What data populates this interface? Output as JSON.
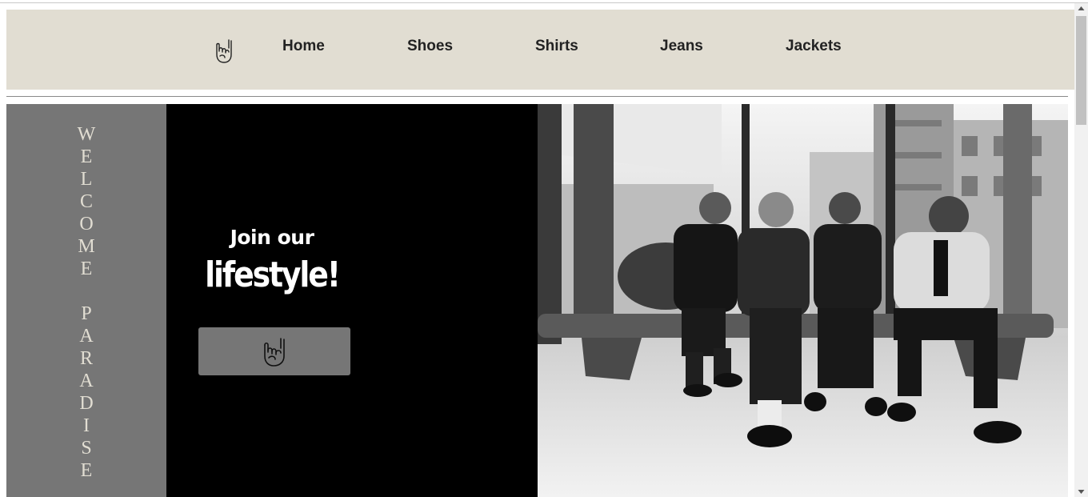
{
  "nav": {
    "logo_icon": "rock-hand-icon",
    "links": [
      "Home",
      "Shoes",
      "Shirts",
      "Jeans",
      "Jackets"
    ]
  },
  "hero": {
    "welcome_letters": [
      "W",
      "E",
      "L",
      "C",
      "O",
      "M",
      "E",
      "",
      "P",
      "A",
      "R",
      "A",
      "D",
      "I",
      "S",
      "E"
    ],
    "join_text": "Join our",
    "lifestyle_text": "lifestyle!",
    "cta_icon": "rock-hand-icon"
  },
  "colors": {
    "nav_bg": "#e1ddd2",
    "side_gray": "#767676",
    "cta_bg": "#000000",
    "text_light": "#e1ddd2"
  },
  "photo": {
    "subject": "band-photo",
    "tone": "black-and-white"
  }
}
